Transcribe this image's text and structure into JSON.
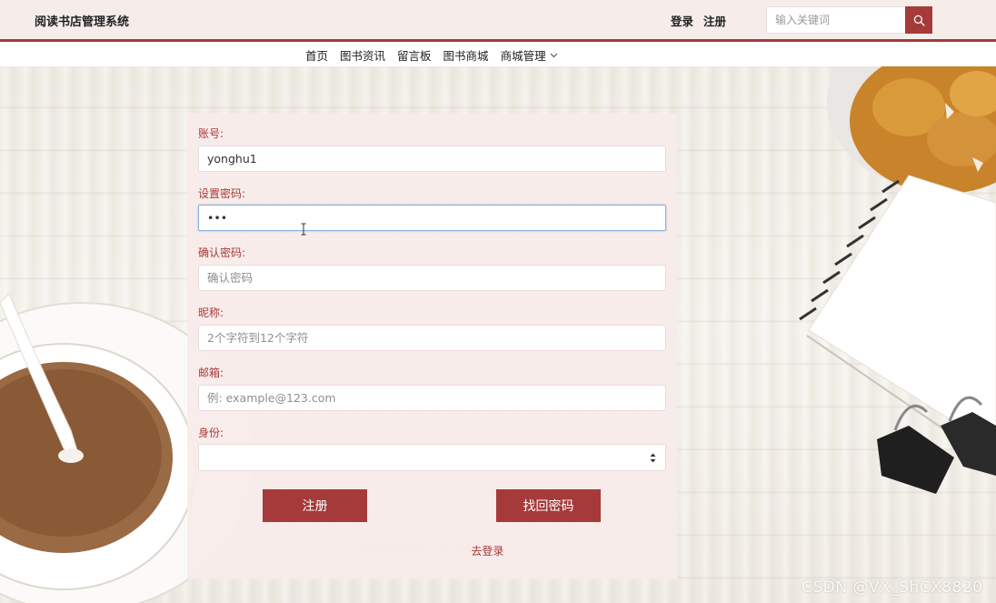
{
  "header": {
    "brand": "阅读书店管理系统",
    "login": "登录",
    "register": "注册",
    "search_placeholder": "输入关键词"
  },
  "nav": {
    "items": [
      "首页",
      "图书资讯",
      "留言板",
      "图书商城",
      "商城管理"
    ]
  },
  "form": {
    "account_label": "账号:",
    "account_value": "yonghu1",
    "password_label": "设置密码:",
    "password_value": "•••",
    "confirm_label": "确认密码:",
    "confirm_placeholder": "确认密码",
    "nickname_label": "昵称:",
    "nickname_placeholder": "2个字符到12个字符",
    "email_label": "邮箱:",
    "email_placeholder": "例: example@123.com",
    "identity_label": "身份:",
    "identity_value": "",
    "register_button": "注册",
    "recover_button": "找回密码",
    "hint_text": "是否已经拥有一个账户?",
    "hint_link": "去登录"
  },
  "watermark": "CSDN @VX_ShCX8820",
  "colors": {
    "accent": "#a63a3a",
    "header_bg": "#f6edeb",
    "panel_bg": "#f8ecea"
  },
  "icons": [
    "search-icon",
    "chevron-down-icon",
    "select-arrows-icon"
  ]
}
